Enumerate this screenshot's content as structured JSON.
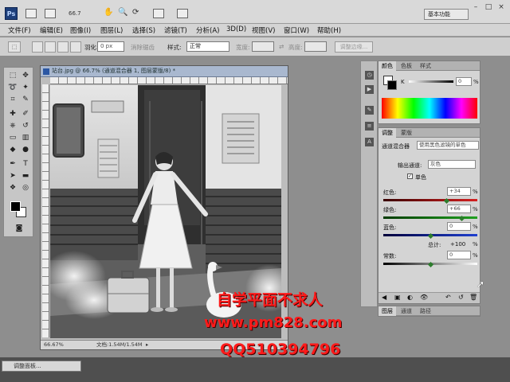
{
  "app": {
    "logo": "Ps",
    "zoom": "66.7",
    "workspace": "基本功能",
    "menu": [
      "文件(F)",
      "编辑(E)",
      "图像(I)",
      "图层(L)",
      "选择(S)",
      "滤镜(T)",
      "分析(A)",
      "3D(D)",
      "视图(V)",
      "窗口(W)",
      "帮助(H)"
    ]
  },
  "options": {
    "feather_label": "羽化:",
    "feather_value": "0 px",
    "antialias_label": "消除锯齿",
    "style_label": "样式:",
    "style_value": "正常",
    "width_label": "宽度:",
    "height_label": "高度:",
    "refine_button": "调整边缘..."
  },
  "document": {
    "title": "站台.jpg @ 66.7% (通道混合器 1, 图层蒙版/8) *",
    "zoom": "66.67%",
    "doc_size": "文档:1.54M/1.54M"
  },
  "color_panel": {
    "tabs": [
      "颜色",
      "色板",
      "样式"
    ],
    "k_label": "K",
    "k_value": "0",
    "k_unit": "%"
  },
  "adjust_panel": {
    "tabs": [
      "调整",
      "蒙版"
    ],
    "preset_label": "通道混合器",
    "preset_value": "使用黑色滤镜的单色",
    "output_label": "输出通道:",
    "output_value": "灰色",
    "mono_label": "单色",
    "red_label": "红色:",
    "red_value": "+34",
    "green_label": "绿色:",
    "green_value": "+66",
    "blue_label": "蓝色:",
    "blue_value": "0",
    "total_label": "总计:",
    "total_value": "+100",
    "constant_label": "常数:",
    "constant_value": "0",
    "unit": "%",
    "slider_red": 0.67,
    "slider_green": 0.83,
    "slider_blue": 0.5,
    "slider_const": 0.5
  },
  "layers_panel": {
    "tabs": [
      "图层",
      "通道",
      "路径"
    ]
  },
  "taskbar": {
    "task_label": "调整面板..."
  },
  "watermark": {
    "line1": "自学平面不求人",
    "line2": "www.pm828.com",
    "line3": "QQ510394796"
  },
  "colors": {
    "watermark": "#ff1a1a",
    "red_channel": "#d42020",
    "green_channel": "#20a020",
    "blue_channel": "#2040d0"
  }
}
